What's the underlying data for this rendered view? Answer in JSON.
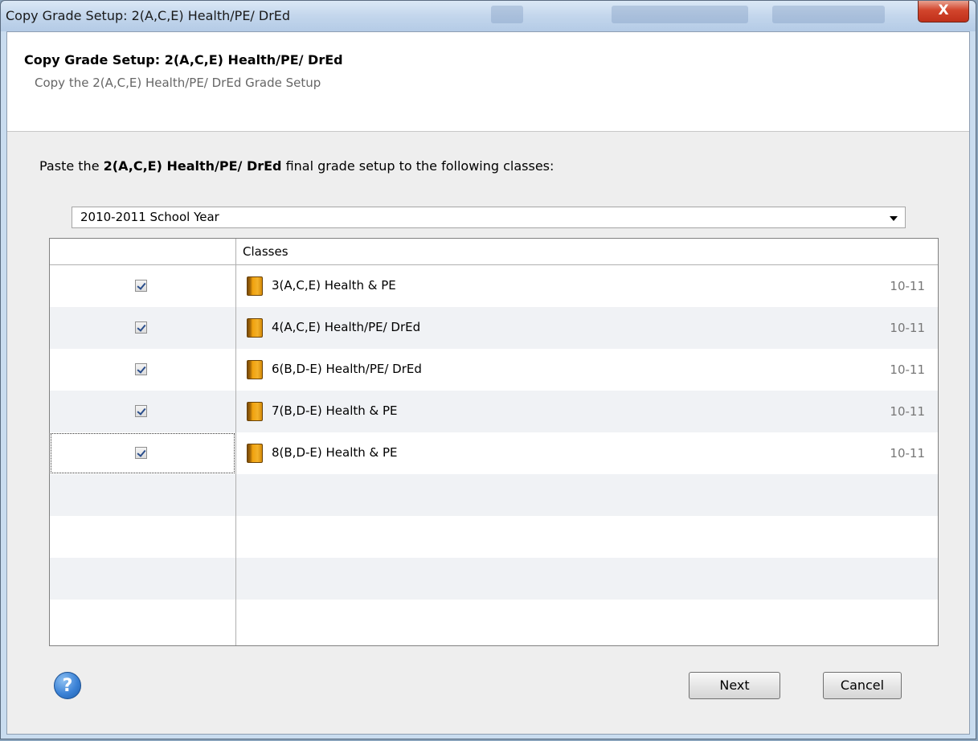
{
  "window": {
    "title": "Copy Grade Setup: 2(A,C,E) Health/PE/ DrEd",
    "close_label": "X"
  },
  "header": {
    "title": "Copy Grade Setup: 2(A,C,E) Health/PE/ DrEd",
    "subtitle": "Copy the 2(A,C,E) Health/PE/ DrEd Grade Setup"
  },
  "instruction": {
    "prefix": "Paste the ",
    "bold": "2(A,C,E) Health/PE/ DrEd",
    "suffix": " final grade setup to the following classes:"
  },
  "year_select": {
    "value": "2010-2011 School Year"
  },
  "table": {
    "header": "Classes",
    "rows": [
      {
        "name": "3(A,C,E) Health & PE",
        "term": "10-11",
        "checked": true
      },
      {
        "name": "4(A,C,E) Health/PE/ DrEd",
        "term": "10-11",
        "checked": true
      },
      {
        "name": "6(B,D-E) Health/PE/ DrEd",
        "term": "10-11",
        "checked": true
      },
      {
        "name": "7(B,D-E) Health & PE",
        "term": "10-11",
        "checked": true
      },
      {
        "name": "8(B,D-E) Health & PE",
        "term": "10-11",
        "checked": true
      }
    ]
  },
  "buttons": {
    "help": "?",
    "next": "Next",
    "cancel": "Cancel"
  },
  "icons": {
    "class_icon": "book-icon",
    "help_icon": "help-icon",
    "checkbox": "check-icon"
  }
}
